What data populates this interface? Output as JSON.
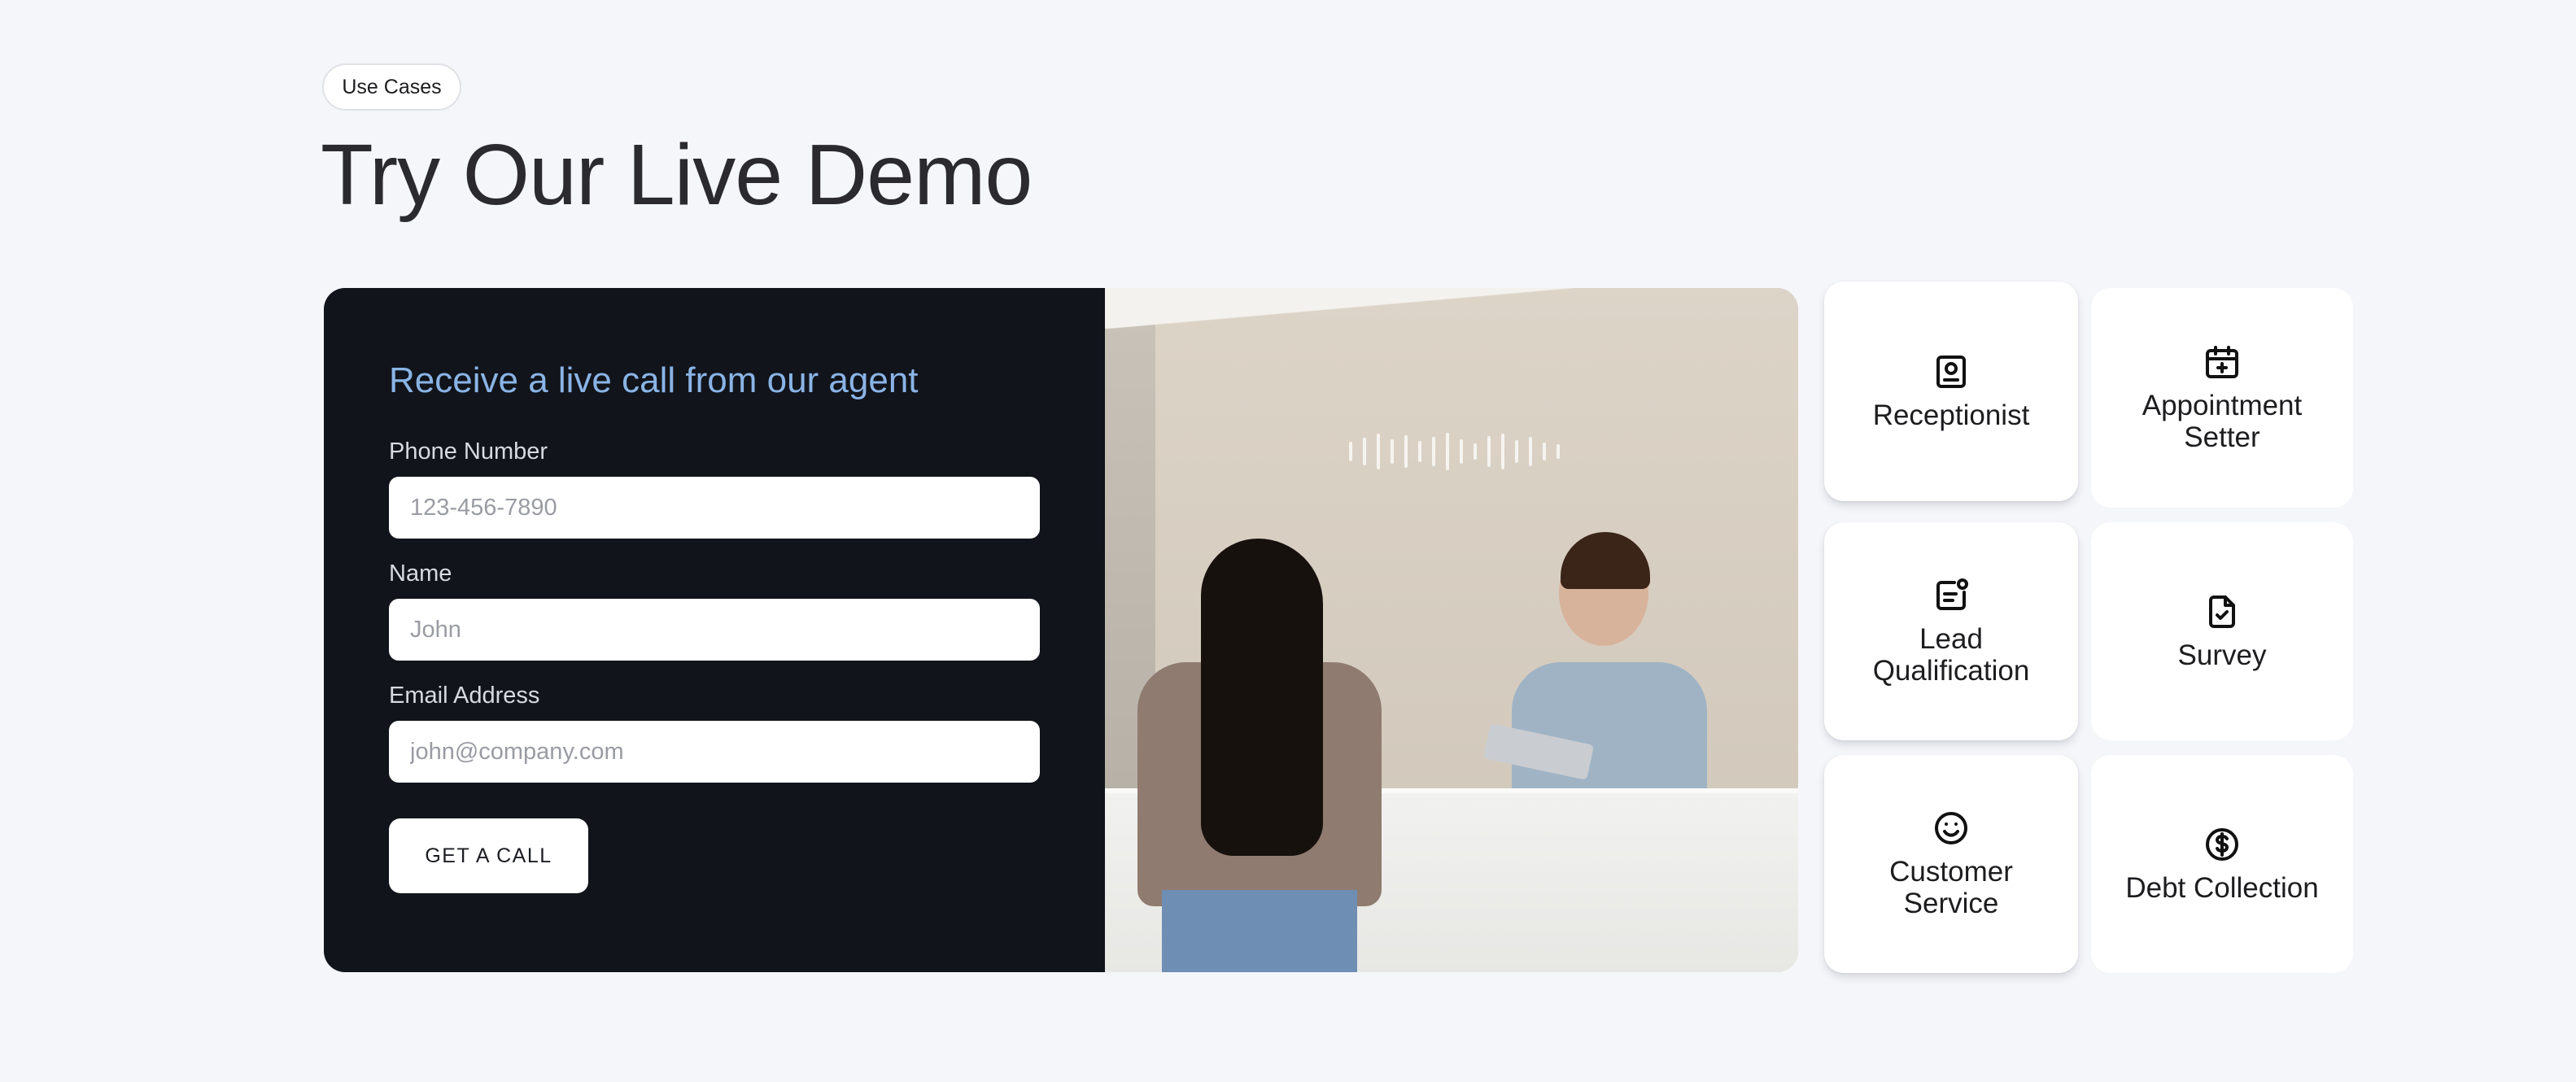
{
  "section_tag": "Use Cases",
  "page_title": "Try Our Live Demo",
  "form": {
    "heading": "Receive a live call from our agent",
    "phone_label": "Phone Number",
    "phone_placeholder": "123-456-7890",
    "name_label": "Name",
    "name_placeholder": "John",
    "email_label": "Email Address",
    "email_placeholder": "john@company.com",
    "submit_label": "GET A CALL"
  },
  "use_cases": [
    {
      "label": "Receptionist",
      "icon": "receptionist-badge-icon"
    },
    {
      "label": "Appointment Setter",
      "icon": "calendar-plus-icon"
    },
    {
      "label": "Lead Qualification",
      "icon": "lead-list-icon"
    },
    {
      "label": "Survey",
      "icon": "document-check-icon"
    },
    {
      "label": "Customer Service",
      "icon": "smiley-face-icon"
    },
    {
      "label": "Debt Collection",
      "icon": "dollar-circle-icon"
    }
  ],
  "colors": {
    "background": "#f5f6fa",
    "form_panel": "#11141b",
    "heading_accent": "#8ab4e6",
    "card": "#ffffff"
  }
}
